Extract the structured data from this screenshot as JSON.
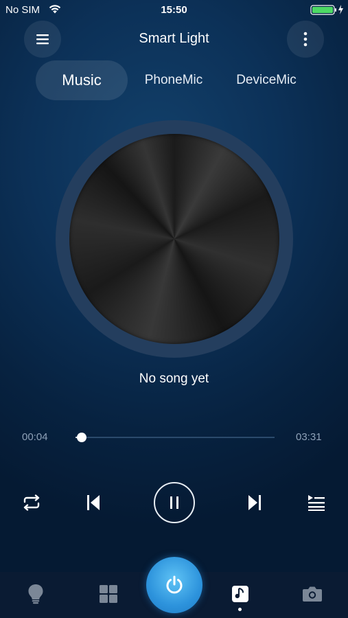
{
  "status_bar": {
    "carrier": "No SIM",
    "time": "15:50",
    "battery_color": "#4cd964"
  },
  "header": {
    "title": "Smart Light",
    "menu_icon": "hamburger-icon",
    "more_icon": "vertical-dots-icon"
  },
  "tabs": [
    {
      "label": "Music",
      "selected": true
    },
    {
      "label": "PhoneMic",
      "selected": false
    },
    {
      "label": "DeviceMic",
      "selected": false
    }
  ],
  "player": {
    "song_title": "No song yet",
    "current_time": "00:04",
    "total_time": "03:31",
    "progress_fraction": 0.03,
    "controls": [
      "repeat-icon",
      "previous-icon",
      "pause-icon",
      "next-icon",
      "playlist-icon"
    ]
  },
  "bottom_nav": {
    "items": [
      "bulb-icon",
      "scenes-grid-icon",
      "power-icon",
      "music-icon",
      "camera-icon"
    ],
    "active": "music-icon",
    "accent": "#2d93dc"
  }
}
